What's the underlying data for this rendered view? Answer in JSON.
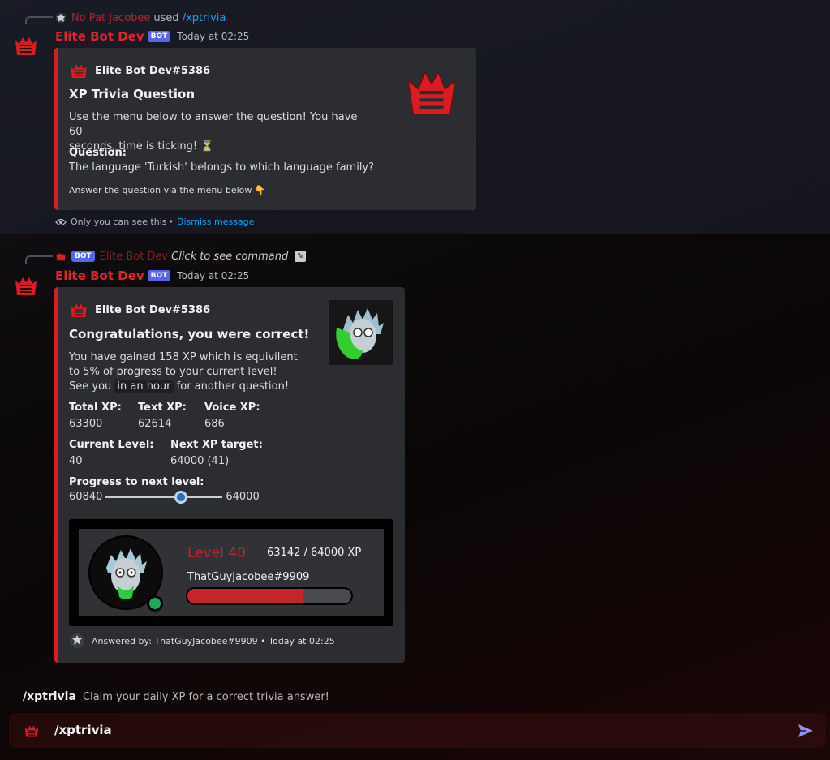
{
  "message1": {
    "reply": {
      "user": "No Pat Jacobee",
      "used_text": "used",
      "command": "/xptrivia"
    },
    "author": "Elite Bot Dev",
    "bot_tag": "BOT",
    "timestamp": "Today at 02:25",
    "embed": {
      "author": "Elite Bot Dev#5386",
      "title": "XP Trivia Question",
      "description_line1": "Use the menu below to answer the question! You have 60",
      "description_line2": "seconds, time is ticking! ⏳",
      "question_label": "Question:",
      "question_text": "The language 'Turkish' belongs to which language family?",
      "hint": "Answer the question via the menu below 👇"
    },
    "ephemeral": {
      "note": "Only you can see this",
      "separator": "•",
      "dismiss": "Dismiss message"
    }
  },
  "message2": {
    "reply": {
      "bot_tag": "BOT",
      "user": "Elite Bot Dev",
      "action": "Click to see command"
    },
    "author": "Elite Bot Dev",
    "bot_tag": "BOT",
    "timestamp": "Today at 02:25",
    "embed": {
      "author": "Elite Bot Dev#5386",
      "title": "Congratulations, you were correct!",
      "desc_line1": "You have gained 158 XP which is equivilent",
      "desc_line2": "to 5% of progress to your current level!",
      "desc_line3_pre": "See you",
      "desc_line3_code": "in an hour",
      "desc_line3_post": "for another question!",
      "fields": {
        "total_xp_label": "Total XP:",
        "total_xp_value": "63300",
        "text_xp_label": "Text XP:",
        "text_xp_value": "62614",
        "voice_xp_label": "Voice XP:",
        "voice_xp_value": "686",
        "current_level_label": "Current Level:",
        "current_level_value": "40",
        "next_target_label": "Next XP target:",
        "next_target_value": "64000 (41)",
        "progress_label": "Progress to next level:"
      },
      "progress": {
        "min": "60840",
        "max": "64000",
        "fraction": 0.64
      },
      "rank_card": {
        "level": "Level 40",
        "xp": "63142 / 64000 XP",
        "username": "ThatGuyJacobee#9909",
        "bar_fraction": 0.71
      },
      "footer": "Answered by: ThatGuyJacobee#9909 • Today at 02:25"
    }
  },
  "command_hint": {
    "name": "/xptrivia",
    "description": "Claim your daily XP for a correct trivia answer!"
  },
  "chat_input": {
    "value": "/xptrivia"
  },
  "colors": {
    "accent_red": "#da1c24",
    "link_blue": "#00a8fc",
    "bot_tag": "#5865f2",
    "online": "#23a55a"
  }
}
